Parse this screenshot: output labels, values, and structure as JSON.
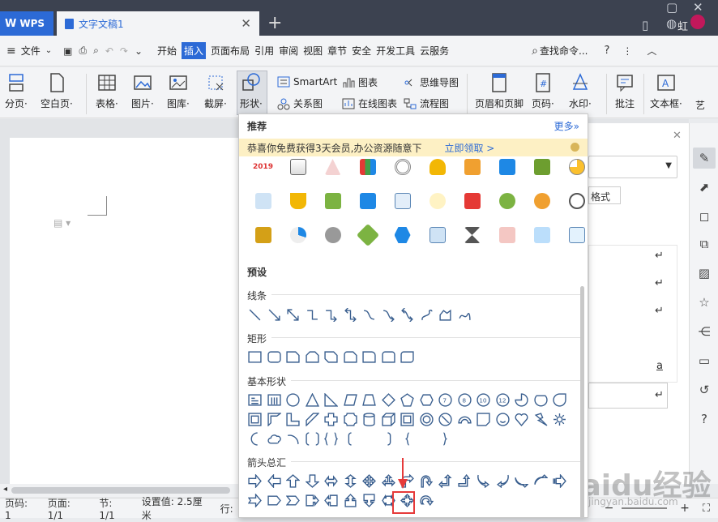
{
  "titlebar": {
    "app_tab": "WPS",
    "doc_tab": "文字文稿1",
    "user": "虹"
  },
  "menubar": {
    "file": "文件",
    "items": [
      "开始",
      "插入",
      "页面布局",
      "引用",
      "审阅",
      "视图",
      "章节",
      "安全",
      "开发工具",
      "云服务"
    ],
    "active": "插入",
    "search": "查找命令..."
  },
  "ribbon": {
    "big": [
      {
        "label": "分页·"
      },
      {
        "label": "空白页·"
      },
      {
        "label": "表格·"
      },
      {
        "label": "图片·"
      },
      {
        "label": "图库·"
      },
      {
        "label": "截屏·"
      },
      {
        "label": "形状·"
      },
      {
        "label": "页眉和页脚"
      },
      {
        "label": "页码·"
      },
      {
        "label": "水印·"
      },
      {
        "label": "批注"
      },
      {
        "label": "文本框·"
      },
      {
        "label": "艺"
      }
    ],
    "small": {
      "smartart": "SmartArt",
      "chart": "图表",
      "mindmap": "思维导图",
      "relation": "关系图",
      "online_chart": "在线图表",
      "flowchart": "流程图"
    }
  },
  "dropdown": {
    "recommend": "推荐",
    "more": "更多»",
    "promo": "恭喜你免费获得3天会员,办公资源随意下",
    "promo_link": "立即领取 >",
    "year_icon": "2019",
    "preset": "预设",
    "sections": {
      "lines": "线条",
      "rect": "矩形",
      "basic": "基本形状",
      "arrows": "箭头总汇"
    }
  },
  "rightpanel": {
    "format_btn": "格式",
    "text_a": "a"
  },
  "status": {
    "page": "页码: 1",
    "pages": "页面: 1/1",
    "section": "节: 1/1",
    "setting": "设置值: 2.5厘米",
    "row": "行:"
  },
  "watermark": {
    "main": "Baidu经验",
    "sub": "jingyan.baidu.com"
  }
}
